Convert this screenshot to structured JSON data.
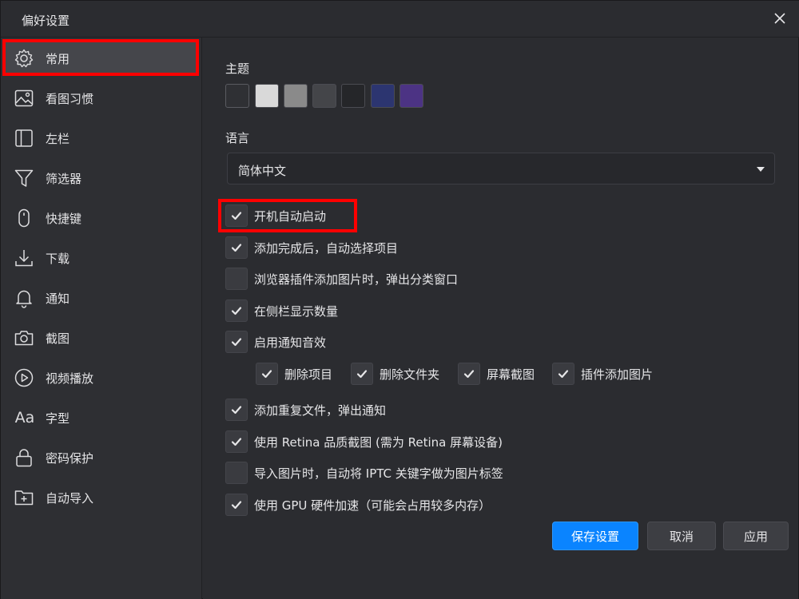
{
  "window": {
    "title": "偏好设置"
  },
  "sidebar": {
    "items": [
      {
        "label": "常用",
        "icon": "gear-icon",
        "active": true
      },
      {
        "label": "看图习惯",
        "icon": "image-icon"
      },
      {
        "label": "左栏",
        "icon": "sidebar-icon"
      },
      {
        "label": "筛选器",
        "icon": "filter-icon"
      },
      {
        "label": "快捷键",
        "icon": "mouse-icon"
      },
      {
        "label": "下载",
        "icon": "download-icon"
      },
      {
        "label": "通知",
        "icon": "bell-icon"
      },
      {
        "label": "截图",
        "icon": "camera-icon"
      },
      {
        "label": "视频播放",
        "icon": "play-icon"
      },
      {
        "label": "字型",
        "icon": "font-icon",
        "icon_text": "Aa"
      },
      {
        "label": "密码保护",
        "icon": "lock-icon"
      },
      {
        "label": "自动导入",
        "icon": "folder-plus-icon"
      }
    ]
  },
  "main": {
    "theme_label": "主题",
    "theme_colors": [
      "#2f3034",
      "#d9d9d9",
      "#8a8a8a",
      "#444549",
      "#252629",
      "#2c3570",
      "#4c3384"
    ],
    "selected_theme": 0,
    "language_label": "语言",
    "language_value": "简体中文",
    "options": [
      {
        "label": "开机自动启动",
        "checked": true
      },
      {
        "label": "添加完成后，自动选择项目",
        "checked": true
      },
      {
        "label": "浏览器插件添加图片时，弹出分类窗口",
        "checked": false
      },
      {
        "label": "在侧栏显示数量",
        "checked": true
      },
      {
        "label": "启用通知音效",
        "checked": true
      }
    ],
    "sound_sub_options": [
      {
        "label": "删除项目",
        "checked": true
      },
      {
        "label": "删除文件夹",
        "checked": true
      },
      {
        "label": "屏幕截图",
        "checked": true
      },
      {
        "label": "插件添加图片",
        "checked": true
      }
    ],
    "options2": [
      {
        "label": "添加重复文件，弹出通知",
        "checked": true
      },
      {
        "label": "使用 Retina 品质截图 (需为 Retina 屏幕设备)",
        "checked": true
      },
      {
        "label": "导入图片时，自动将 IPTC 关键字做为图片标签",
        "checked": false
      },
      {
        "label": "使用 GPU 硬件加速（可能会占用较多内存）",
        "checked": true
      }
    ]
  },
  "footer": {
    "save_label": "保存设置",
    "cancel_label": "取消",
    "apply_label": "应用"
  },
  "colors": {
    "accent": "#0a84ff",
    "highlight": "#ff0000",
    "background": "#2b2c30"
  }
}
